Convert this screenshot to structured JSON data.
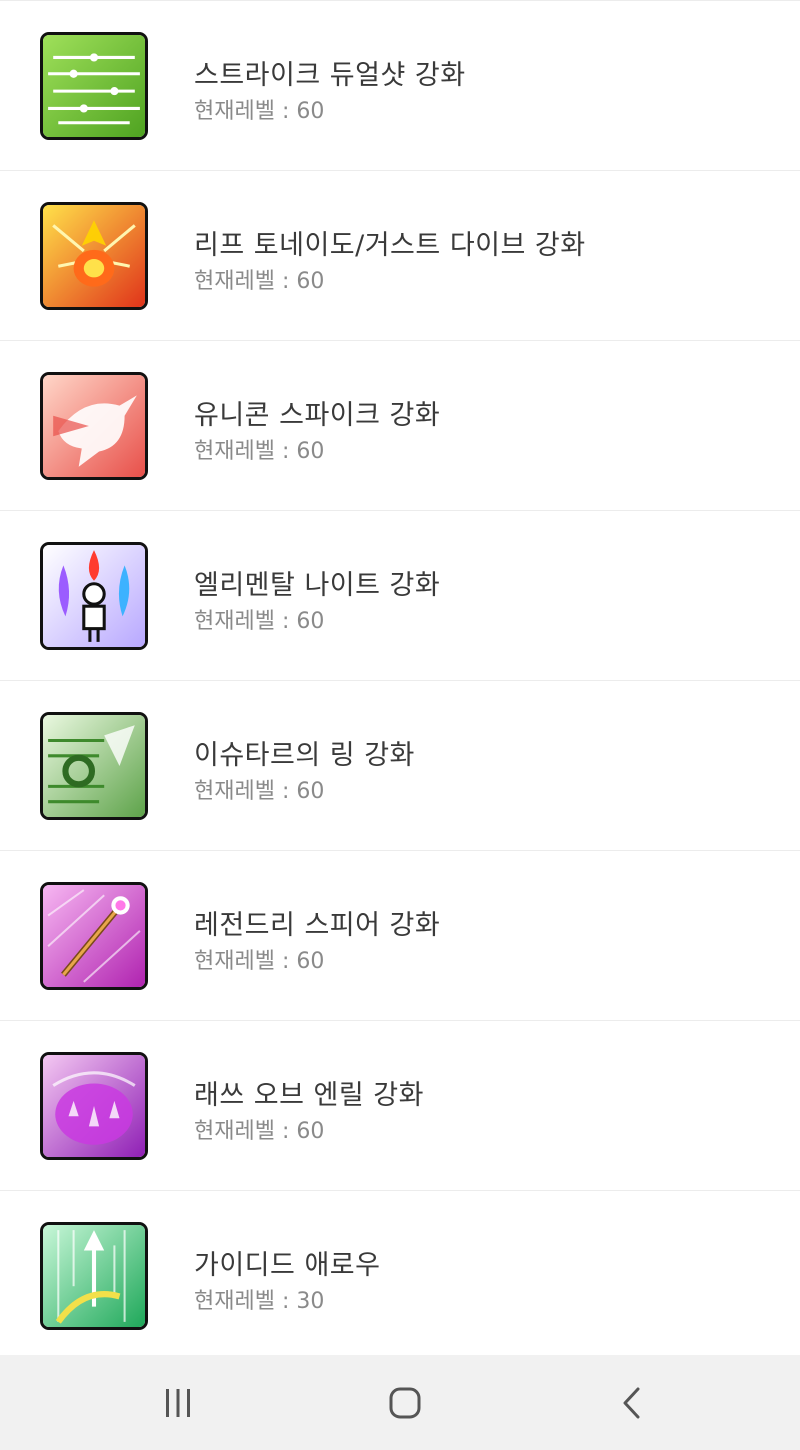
{
  "skills": [
    {
      "name": "스트라이크 듀얼샷 강화",
      "level": "현재레벨 : 60",
      "icon": "strike-dual-shot-icon",
      "colors": [
        "#9fe05a",
        "#4fa321"
      ]
    },
    {
      "name": "리프 토네이도/거스트 다이브 강화",
      "level": "현재레벨 : 60",
      "icon": "leaf-tornado-icon",
      "colors": [
        "#ffe14a",
        "#e0331a"
      ]
    },
    {
      "name": "유니콘 스파이크 강화",
      "level": "현재레벨 : 60",
      "icon": "unicorn-spike-icon",
      "colors": [
        "#ffd6c8",
        "#e8504a"
      ]
    },
    {
      "name": "엘리멘탈 나이트 강화",
      "level": "현재레벨 : 60",
      "icon": "elemental-knight-icon",
      "colors": [
        "#ffffff",
        "#b8a8ff"
      ]
    },
    {
      "name": "이슈타르의 링 강화",
      "level": "현재레벨 : 60",
      "icon": "ishtar-ring-icon",
      "colors": [
        "#eaf8e0",
        "#5ea34a"
      ]
    },
    {
      "name": "레전드리 스피어 강화",
      "level": "현재레벨 : 60",
      "icon": "legendary-spear-icon",
      "colors": [
        "#f7b7f2",
        "#b023b0"
      ]
    },
    {
      "name": "래쓰 오브 엔릴 강화",
      "level": "현재레벨 : 60",
      "icon": "wrath-of-enlil-icon",
      "colors": [
        "#f4c8f2",
        "#8f1fb5"
      ]
    },
    {
      "name": "가이디드 애로우",
      "level": "현재레벨 : 30",
      "icon": "guided-arrow-icon",
      "colors": [
        "#c8f7d8",
        "#1fa85a"
      ]
    }
  ],
  "navbar": {
    "recent": "recent-apps-icon",
    "home": "home-icon",
    "back": "back-icon"
  }
}
